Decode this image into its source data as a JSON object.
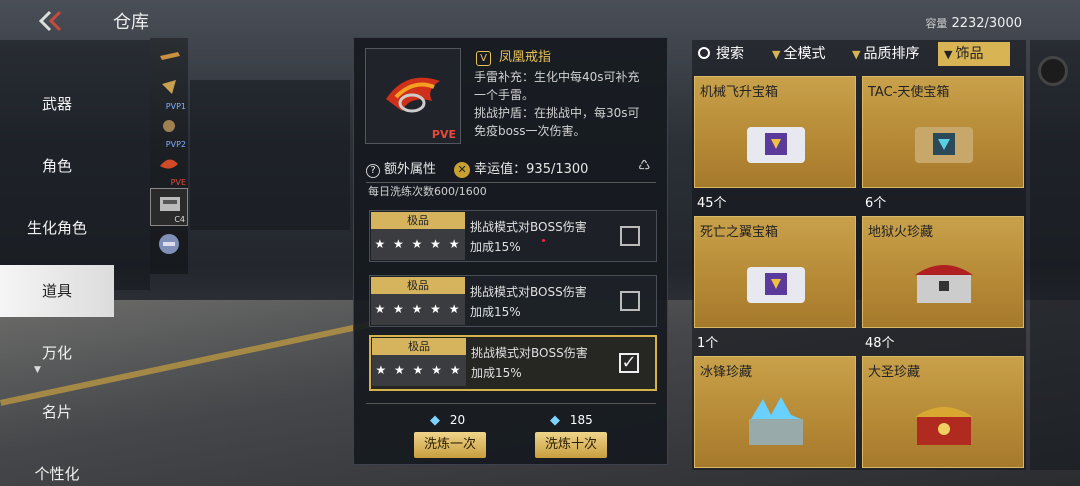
{
  "header": {
    "title": "仓库",
    "capacity_label": "容量",
    "capacity_value": "2232/3000"
  },
  "nav": {
    "items": [
      "武器",
      "角色",
      "生化角色",
      "道具",
      "万化",
      "名片",
      "个性化"
    ],
    "active": "道具"
  },
  "thumb_strip": {
    "tags": [
      "",
      "PVP1",
      "PVP2",
      "PVE",
      "C4",
      "",
      ""
    ]
  },
  "item": {
    "name": "凤凰戒指",
    "mode_tag": "PVE",
    "desc_lines": [
      "手雷补充：生化中每40s可补充",
      "一个手雷。",
      "挑战护盾：在挑战中，每30s可",
      "免疫boss一次伤害。"
    ]
  },
  "attributes": {
    "extra_label": "额外属性",
    "luck_label": "幸运值：935/1300",
    "daily_count": "每日洗练次数600/1600"
  },
  "options": [
    {
      "grade": "极品",
      "stars": "★ ★ ★ ★ ★",
      "line1": "挑战模式对BOSS伤害",
      "line2": "加成15%",
      "checked": false
    },
    {
      "grade": "极品",
      "stars": "★ ★ ★ ★ ★",
      "line1": "挑战模式对BOSS伤害",
      "line2": "加成15%",
      "checked": false
    },
    {
      "grade": "极品",
      "stars": "★ ★ ★ ★ ★",
      "line1": "挑战模式对BOSS伤害",
      "line2": "加成15%",
      "checked": true
    }
  ],
  "actions": {
    "once_cost": "20",
    "once_label": "洗炼一次",
    "ten_cost": "185",
    "ten_label": "洗炼十次"
  },
  "filters": {
    "search": "搜索",
    "mode": "全模式",
    "sort": "品质排序",
    "category": "饰品"
  },
  "grid": [
    {
      "name": "机械飞升宝箱",
      "count": "45个"
    },
    {
      "name": "TAC-天使宝箱",
      "count": "6个"
    },
    {
      "name": "死亡之翼宝箱",
      "count": "1个"
    },
    {
      "name": "地狱火珍藏",
      "count": "48个"
    },
    {
      "name": "冰锋珍藏",
      "count": ""
    },
    {
      "name": "大圣珍藏",
      "count": ""
    }
  ],
  "colors": {
    "accent_gold": "#d9b455",
    "card_gold": "#b68a36",
    "pve_red": "#e64a3a"
  }
}
